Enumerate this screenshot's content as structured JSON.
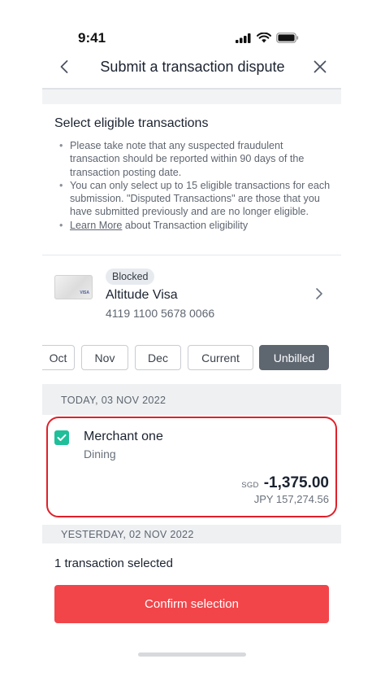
{
  "status_bar": {
    "time": "9:41",
    "icons": [
      "cellular-icon",
      "wifi-icon",
      "battery-icon"
    ]
  },
  "header": {
    "title": "Submit a transaction dispute",
    "back_icon": "chevron-left-icon",
    "close_icon": "close-icon"
  },
  "eligibility": {
    "title": "Select eligible transactions",
    "notes": [
      "Please take note that any suspected fraudulent transaction should be reported within 90 days of the transaction posting date.",
      "You can only select up to 15 eligible transactions for each submission. \"Disputed Transactions\" are those that you have submitted previously and are no longer eligible."
    ],
    "learn_more_link": "Learn More",
    "learn_more_suffix": " about Transaction eligibility"
  },
  "card": {
    "badge": "Blocked",
    "name": "Altitude Visa",
    "number": "4119 1100 5678 0066",
    "brand": "VISA"
  },
  "month_tabs": [
    {
      "label": "Oct",
      "active": false
    },
    {
      "label": "Nov",
      "active": false
    },
    {
      "label": "Dec",
      "active": false
    },
    {
      "label": "Current",
      "active": false
    },
    {
      "label": "Unbilled",
      "active": true
    }
  ],
  "groups": [
    {
      "date_label": "TODAY, 03 NOV 2022",
      "transactions": [
        {
          "merchant": "Merchant one",
          "category": "Dining",
          "currency": "SGD",
          "amount": "-1,375.00",
          "foreign_amount": "JPY 157,274.56",
          "selected": true
        }
      ]
    },
    {
      "date_label": "YESTERDAY, 02 NOV 2022",
      "transactions": []
    }
  ],
  "footer": {
    "selected_count": "1 transaction selected",
    "confirm_label": "Confirm selection"
  },
  "colors": {
    "accent_red": "#f2454a",
    "highlight_red": "#e0202a",
    "checkbox_green": "#1fbf9a",
    "active_tab": "#5e6670"
  }
}
